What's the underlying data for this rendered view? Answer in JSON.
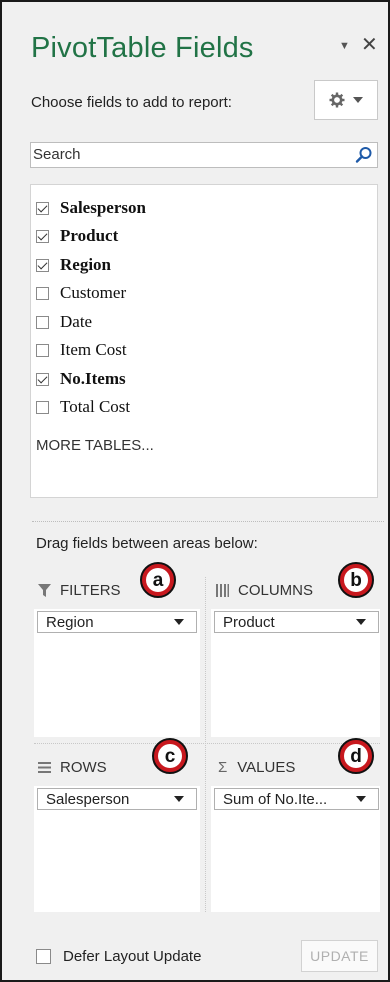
{
  "pane": {
    "title": "PivotTable Fields",
    "choose_label": "Choose fields to add to report:",
    "search_placeholder": "Search",
    "more_tables": "MORE TABLES...",
    "drag_label": "Drag fields between areas below:"
  },
  "fields": [
    {
      "label": "Salesperson",
      "checked": true
    },
    {
      "label": "Product",
      "checked": true
    },
    {
      "label": "Region",
      "checked": true
    },
    {
      "label": "Customer",
      "checked": false
    },
    {
      "label": "Date",
      "checked": false
    },
    {
      "label": "Item Cost",
      "checked": false
    },
    {
      "label": "No.Items",
      "checked": true
    },
    {
      "label": "Total Cost",
      "checked": false
    }
  ],
  "areas": {
    "filters": {
      "label": "FILTERS",
      "field": "Region",
      "badge": "a"
    },
    "columns": {
      "label": "COLUMNS",
      "field": "Product",
      "badge": "b"
    },
    "rows": {
      "label": "ROWS",
      "field": "Salesperson",
      "badge": "c"
    },
    "values": {
      "label": "VALUES",
      "field": "Sum of No.Ite...",
      "badge": "d",
      "sigma": "Σ"
    }
  },
  "footer": {
    "defer_label": "Defer Layout Update",
    "update_label": "UPDATE"
  },
  "colors": {
    "title_green": "#217346",
    "badge_red": "#c8181e"
  },
  "icons": {
    "dropdown": "dropdown-arrow-icon",
    "close": "close-icon",
    "gear": "gear-icon",
    "search": "search-icon",
    "filter": "filter-funnel-icon",
    "columns": "columns-bars-icon",
    "rows": "rows-lines-icon",
    "values": "sigma-icon"
  }
}
